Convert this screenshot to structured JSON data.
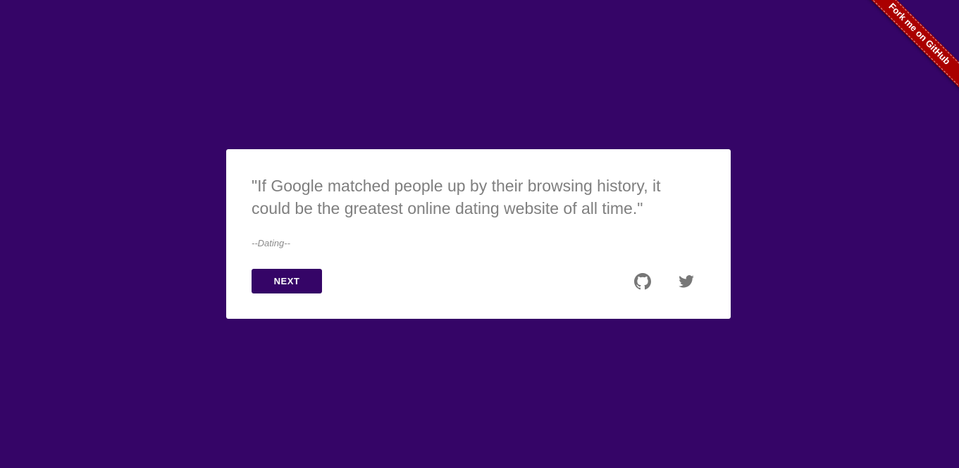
{
  "quote": {
    "text": "\"If Google matched people up by their browsing history, it could be the greatest online dating website of all time.\"",
    "author": "--Dating--"
  },
  "actions": {
    "next_label": "NEXT",
    "github_icon": "github-icon",
    "twitter_icon": "twitter-icon"
  },
  "ribbon": {
    "label": "Fork me on GitHub"
  },
  "colors": {
    "background": "#350567",
    "card": "#ffffff",
    "text": "#7f7f7f",
    "button": "#350567",
    "ribbon": "#aa0000",
    "icon": "#777777"
  }
}
